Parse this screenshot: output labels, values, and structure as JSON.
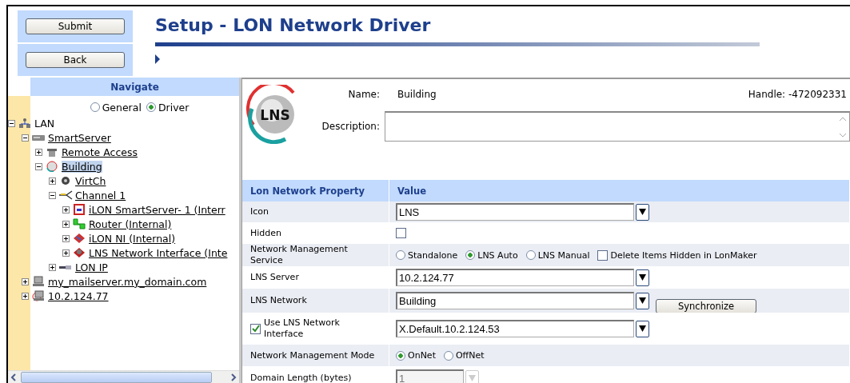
{
  "header": {
    "buttons": [
      "Submit",
      "Back"
    ],
    "title": "Setup - LON Network Driver"
  },
  "navigate": {
    "title": "Navigate",
    "views": [
      {
        "label": "General",
        "selected": false
      },
      {
        "label": "Driver",
        "selected": true
      }
    ],
    "tree": [
      {
        "label": "LAN",
        "kind": "network",
        "expanded": true,
        "selected": false,
        "children": [
          {
            "label": "SmartServer",
            "kind": "server",
            "expanded": true,
            "selected": false,
            "children": [
              {
                "label": "Remote Access",
                "kind": "phone",
                "expanded": false,
                "selected": false
              },
              {
                "label": "Building",
                "kind": "lns",
                "expanded": true,
                "selected": true,
                "children": [
                  {
                    "label": "VirtCh",
                    "kind": "virtual",
                    "expanded": false,
                    "selected": false
                  },
                  {
                    "label": "Channel 1",
                    "kind": "channel",
                    "expanded": true,
                    "selected": false,
                    "children": [
                      {
                        "label": "iLON SmartServer- 1 (Interr",
                        "kind": "device",
                        "expanded": false,
                        "selected": false
                      },
                      {
                        "label": "Router (Internal)",
                        "kind": "router",
                        "expanded": false,
                        "selected": false
                      },
                      {
                        "label": "iLON NI (Internal)",
                        "kind": "ni",
                        "expanded": false,
                        "selected": false
                      },
                      {
                        "label": "LNS Network Interface (Inte",
                        "kind": "lnsni",
                        "expanded": false,
                        "selected": false
                      }
                    ]
                  },
                  {
                    "label": "LON IP",
                    "kind": "lonip",
                    "expanded": false,
                    "selected": false
                  }
                ]
              }
            ]
          },
          {
            "label": "my_mailserver.my_domain.com",
            "kind": "computer",
            "expanded": false,
            "selected": false
          },
          {
            "label": "10.2.124.77",
            "kind": "lnsserver",
            "expanded": false,
            "selected": false
          }
        ]
      }
    ]
  },
  "info": {
    "logo": "LNS",
    "name_label": "Name:",
    "name": "Building",
    "handle": "Handle: -472092331",
    "description_label": "Description:"
  },
  "table": {
    "columns": [
      "Lon Network Property",
      "Value"
    ],
    "rows": [
      {
        "kind": "select",
        "label": "Icon",
        "value": "LNS"
      },
      {
        "kind": "checkbox",
        "label": "Hidden",
        "checked": false
      },
      {
        "kind": "radios",
        "label": "Network Management Service",
        "options": [
          {
            "label": "Standalone",
            "selected": false
          },
          {
            "label": "LNS Auto",
            "selected": true
          },
          {
            "label": "LNS Manual",
            "selected": false
          }
        ],
        "extra": {
          "label": "Delete Items Hidden in LonMaker",
          "checked": false
        }
      },
      {
        "kind": "select",
        "label": "LNS Server",
        "value": "10.2.124.77"
      },
      {
        "kind": "select",
        "label": "LNS Network",
        "value": "Building",
        "button": "Synchronize"
      },
      {
        "kind": "checkselect",
        "label": "Use LNS Network Interface",
        "checked": true,
        "value": "X.Default.10.2.124.53"
      },
      {
        "kind": "radios",
        "label": "Network Management Mode",
        "options": [
          {
            "label": "OnNet",
            "selected": true
          },
          {
            "label": "OffNet",
            "selected": false
          }
        ]
      },
      {
        "kind": "small",
        "label": "Domain Length (bytes)",
        "value": "1",
        "disabled": true
      }
    ]
  }
}
